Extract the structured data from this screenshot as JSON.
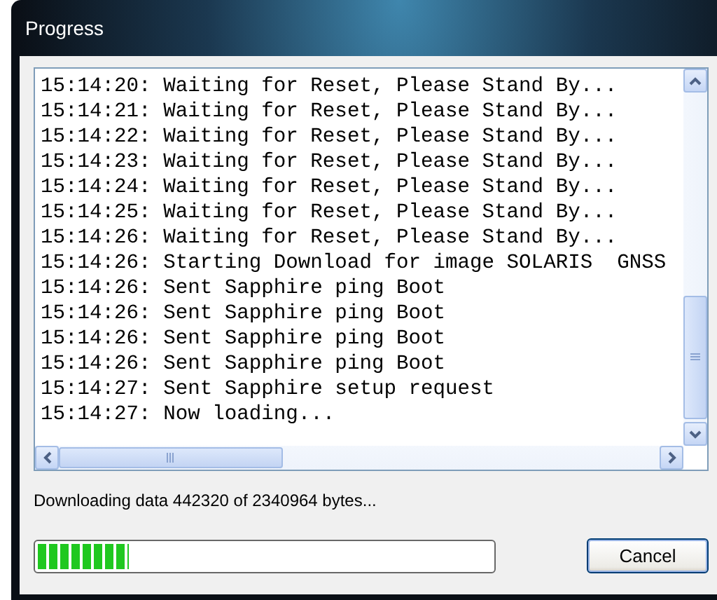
{
  "window": {
    "title": "Progress"
  },
  "log": {
    "lines": [
      "15:14:20: Waiting for Reset, Please Stand By...",
      "15:14:21: Waiting for Reset, Please Stand By...",
      "15:14:22: Waiting for Reset, Please Stand By...",
      "15:14:23: Waiting for Reset, Please Stand By...",
      "15:14:24: Waiting for Reset, Please Stand By...",
      "15:14:25: Waiting for Reset, Please Stand By...",
      "15:14:26: Waiting for Reset, Please Stand By...",
      "15:14:26: Starting Download for image SOLARIS  GNSS",
      "15:14:26: Sent Sapphire ping Boot",
      "15:14:26: Sent Sapphire ping Boot",
      "15:14:26: Sent Sapphire ping Boot",
      "15:14:26: Sent Sapphire ping Boot",
      "15:14:27: Sent Sapphire setup request",
      "15:14:27: Now loading..."
    ]
  },
  "status": "Downloading data 442320 of 2340964 bytes...",
  "progress": {
    "level": 0.2
  },
  "buttons": [
    {
      "label": "Cancel"
    }
  ]
}
